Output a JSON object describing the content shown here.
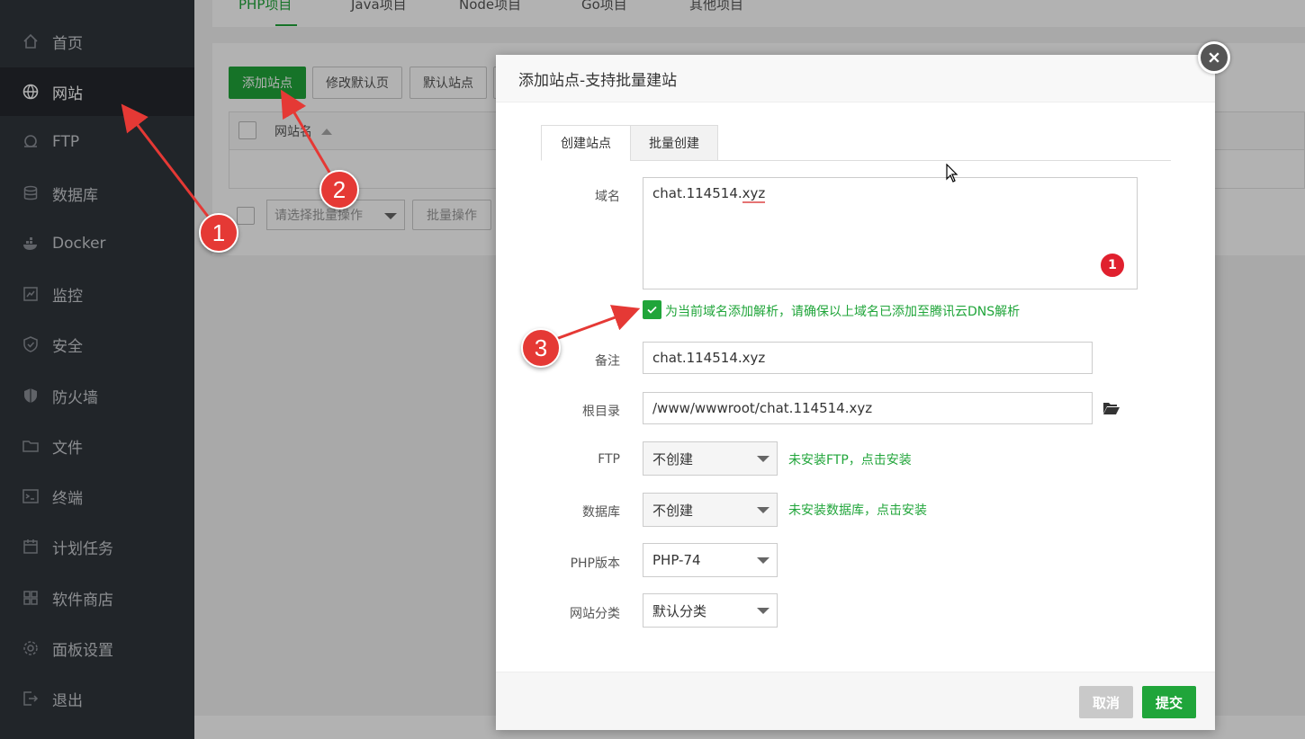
{
  "sidebar": {
    "items": [
      {
        "label": "首页",
        "icon": "home-icon"
      },
      {
        "label": "网站",
        "icon": "globe-icon",
        "active": true
      },
      {
        "label": "FTP",
        "icon": "ftp-icon"
      },
      {
        "label": "数据库",
        "icon": "database-icon"
      },
      {
        "label": "Docker",
        "icon": "docker-icon"
      },
      {
        "label": "监控",
        "icon": "monitor-icon"
      },
      {
        "label": "安全",
        "icon": "shield-check-icon"
      },
      {
        "label": "防火墙",
        "icon": "firewall-shield-icon"
      },
      {
        "label": "文件",
        "icon": "folder-icon"
      },
      {
        "label": "终端",
        "icon": "terminal-icon"
      },
      {
        "label": "计划任务",
        "icon": "calendar-icon"
      },
      {
        "label": "软件商店",
        "icon": "apps-grid-icon"
      },
      {
        "label": "面板设置",
        "icon": "gear-icon"
      },
      {
        "label": "退出",
        "icon": "logout-icon"
      }
    ]
  },
  "project_tabs": [
    "PHP项目",
    "Java项目",
    "Node项目",
    "Go项目",
    "其他项目"
  ],
  "toolbar": {
    "add_site": "添加站点",
    "modify_default_page": "修改默认页",
    "default_site": "默认站点"
  },
  "table": {
    "col_site_name": "网站名"
  },
  "bulk": {
    "select_placeholder": "请选择批量操作",
    "bulk_button": "批量操作"
  },
  "modal": {
    "title": "添加站点-支持批量建站",
    "tabs": [
      "创建站点",
      "批量创建"
    ],
    "domain_label": "域名",
    "domain_value_prefix": "chat.114514.",
    "domain_value_suffix": "xyz",
    "domain_badge": "1",
    "dns_checkbox_text": "为当前域名添加解析，请确保以上域名已添加至腾讯云DNS解析",
    "remark_label": "备注",
    "remark_value": "chat.114514.xyz",
    "root_label": "根目录",
    "root_value": "/www/wwwroot/chat.114514.xyz",
    "ftp_label": "FTP",
    "ftp_value": "不创建",
    "ftp_hint": "未安装FTP，点击安装",
    "db_label": "数据库",
    "db_value": "不创建",
    "db_hint": "未安装数据库，点击安装",
    "php_label": "PHP版本",
    "php_value": "PHP-74",
    "category_label": "网站分类",
    "category_value": "默认分类",
    "cancel": "取消",
    "submit": "提交"
  },
  "annotations": [
    "1",
    "2",
    "3"
  ],
  "colors": {
    "sidebar_bg": "#30353c",
    "accent_green": "#20a53a",
    "annotation_red": "#e53935"
  }
}
